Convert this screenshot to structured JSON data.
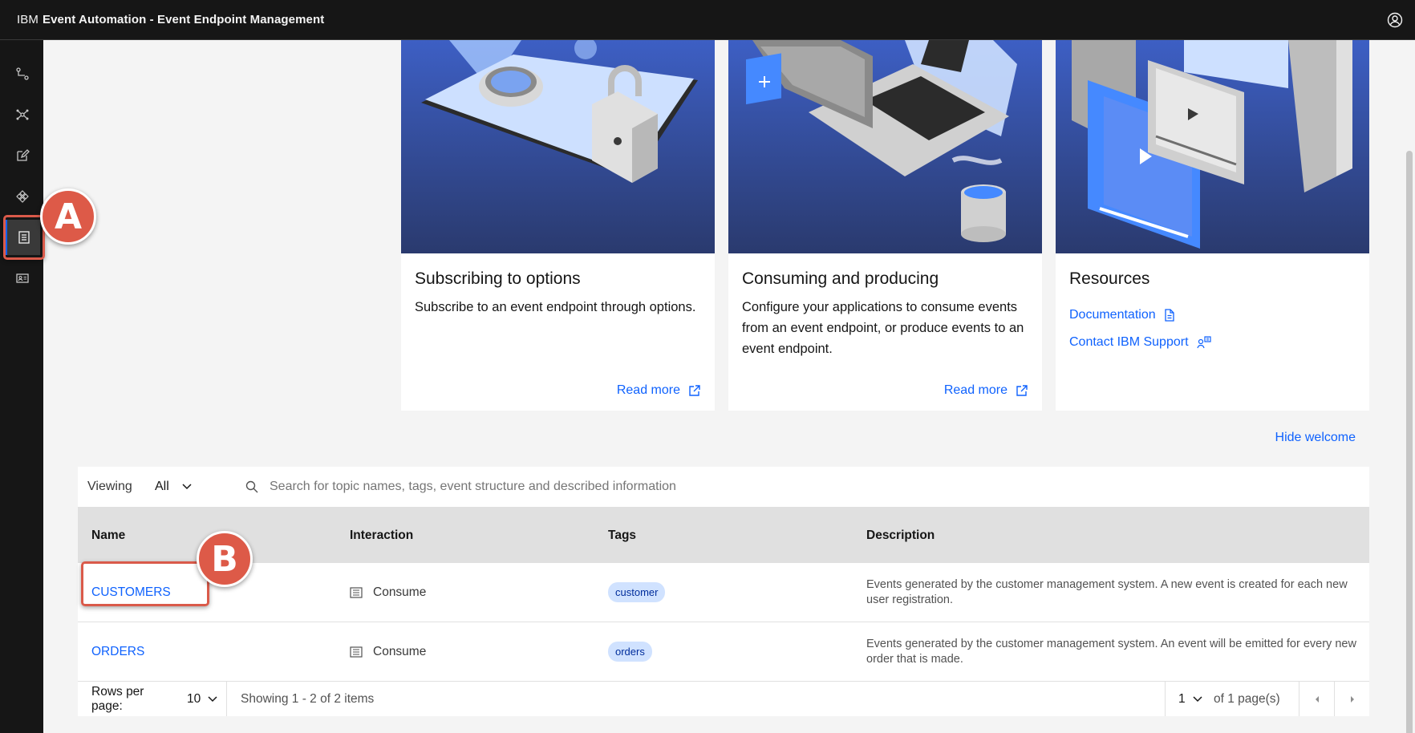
{
  "header": {
    "brand_prefix": "IBM",
    "product_name": "Event Automation - Event Endpoint Management",
    "user_icon": "user-avatar-icon"
  },
  "siderail": {
    "items": [
      {
        "icon": "topology-icon"
      },
      {
        "icon": "network-icon"
      },
      {
        "icon": "edit-icon"
      },
      {
        "icon": "plugin-icon"
      },
      {
        "icon": "catalog-icon",
        "active": true
      },
      {
        "icon": "id-badge-icon"
      }
    ]
  },
  "cards": [
    {
      "title": "Subscribing to options",
      "description": "Subscribe to an event endpoint through options.",
      "link": "Read more"
    },
    {
      "title": "Consuming and producing",
      "description": "Configure your applications to consume events from an event endpoint, or produce events to an event endpoint.",
      "link": "Read more"
    },
    {
      "title": "Resources",
      "links": [
        "Documentation",
        "Contact IBM Support"
      ]
    }
  ],
  "hide_welcome": "Hide welcome",
  "toolbar": {
    "viewing_label": "Viewing",
    "viewing_value": "All",
    "search_placeholder": "Search for topic names, tags, event structure and described information"
  },
  "table": {
    "headers": [
      "Name",
      "Interaction",
      "Tags",
      "Description"
    ],
    "rows": [
      {
        "name": "CUSTOMERS",
        "interaction": "Consume",
        "tag": "customer",
        "description": "Events generated by the customer management system. A new event is created for each new user registration."
      },
      {
        "name": "ORDERS",
        "interaction": "Consume",
        "tag": "orders",
        "description": "Events generated by the customer management system. An event will be emitted for every new order that is made."
      }
    ]
  },
  "pagination": {
    "rows_per_page_label": "Rows per page:",
    "rows_per_page": "10",
    "showing": "Showing 1 - 2 of 2 items",
    "page": "1",
    "of_pages": "of 1 page(s)"
  },
  "annotations": {
    "a": "A",
    "b": "B",
    "color": "#dd5a48"
  },
  "colors": {
    "link": "#0f62fe",
    "header_bg": "#161616",
    "tag_bg": "#d0e2ff"
  }
}
